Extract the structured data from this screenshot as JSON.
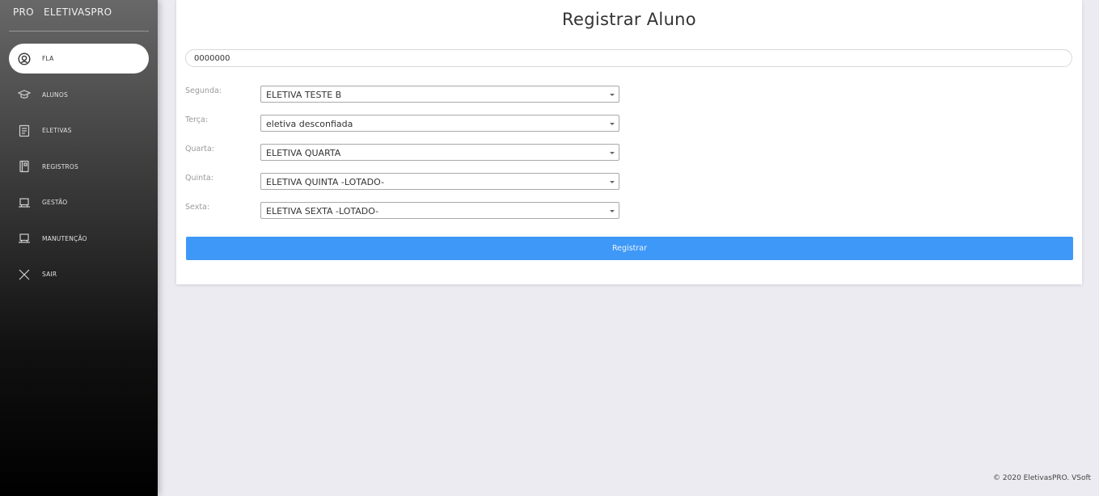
{
  "sidebar": {
    "brand_logo": "PRO",
    "brand_name": "ELETIVASPRO",
    "items": [
      {
        "label": "FLA",
        "icon": "user-circle-icon",
        "active": true
      },
      {
        "label": "ALUNOS",
        "icon": "graduation-cap-icon",
        "active": false
      },
      {
        "label": "ELETIVAS",
        "icon": "document-icon",
        "active": false
      },
      {
        "label": "REGISTROS",
        "icon": "notebook-icon",
        "active": false
      },
      {
        "label": "GESTÃO",
        "icon": "laptop-icon",
        "active": false
      },
      {
        "label": "MANUTENÇÃO",
        "icon": "laptop-icon",
        "active": false
      },
      {
        "label": "SAIR",
        "icon": "close-icon",
        "active": false
      }
    ]
  },
  "form": {
    "title": "Registrar Aluno",
    "student_id": "0000000",
    "days": [
      {
        "label": "Segunda:",
        "selected": "ELETIVA TESTE B"
      },
      {
        "label": "Terça:",
        "selected": "eletiva desconfiada"
      },
      {
        "label": "Quarta:",
        "selected": "ELETIVA QUARTA"
      },
      {
        "label": "Quinta:",
        "selected": "ELETIVA QUINTA -LOTADO-"
      },
      {
        "label": "Sexta:",
        "selected": "ELETIVA SEXTA -LOTADO-"
      }
    ],
    "submit_label": "Registrar"
  },
  "footer": {
    "text": "© 2020 EletivasPRO. VSoft"
  },
  "colors": {
    "primary_button": "#3e98f7",
    "background": "#ebebf1",
    "sidebar_top": "#686868",
    "sidebar_bottom": "#000000"
  }
}
